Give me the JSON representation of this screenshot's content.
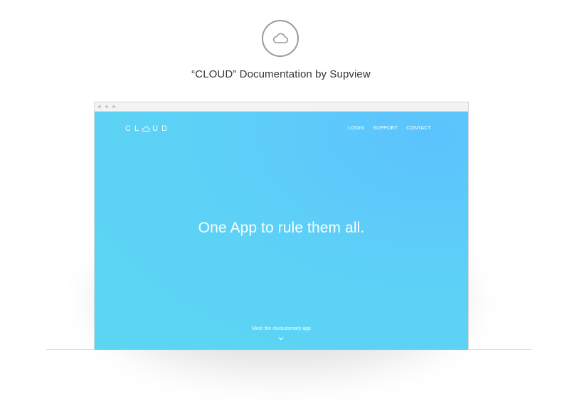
{
  "header": {
    "icon": "cloud-icon",
    "title": "“CLOUD” Documentation by Supview"
  },
  "browser": {
    "nav": {
      "logo_text_left": "CL",
      "logo_text_right": "UD",
      "links": [
        "LOGIN",
        "SUPPORT",
        "CONTACT"
      ]
    },
    "hero": {
      "headline": "One App to rule them all.",
      "tagline": "Meet the revolutionary app",
      "scroll_icon": "chevron-down-icon"
    }
  },
  "colors": {
    "hero_gradient_start": "#5bd6f2",
    "hero_gradient_end": "#5cc3fd",
    "icon_gray": "#9a9a9a"
  }
}
